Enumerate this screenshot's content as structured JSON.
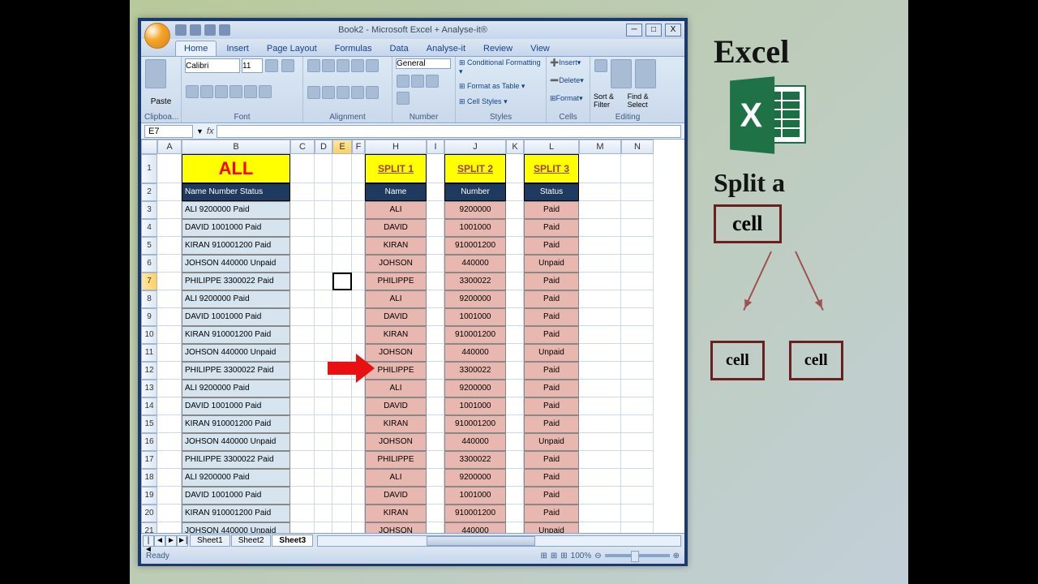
{
  "title": "Book2 - Microsoft Excel + Analyse-it®",
  "tabs": [
    "Home",
    "Insert",
    "Page Layout",
    "Formulas",
    "Data",
    "Analyse-it",
    "Review",
    "View"
  ],
  "activeTab": "Home",
  "ribbonGroups": {
    "clipboard": "Clipboa...",
    "font": "Font",
    "fontName": "Calibri",
    "fontSize": "11",
    "alignment": "Alignment",
    "numberFormat": "General",
    "number": "Number",
    "styles": "Styles",
    "stylesBtns": [
      "Conditional Formatting",
      "Format as Table",
      "Cell Styles"
    ],
    "cells": "Cells",
    "cellsBtns": [
      "Insert",
      "Delete",
      "Format"
    ],
    "editing": "Editing",
    "editBtns": [
      "Sort & Filter",
      "Find & Select"
    ]
  },
  "nameBox": "E7",
  "formulaValue": "",
  "columns": [
    "A",
    "B",
    "C",
    "D",
    "E",
    "F",
    "H",
    "I",
    "J",
    "K",
    "L",
    "M",
    "N"
  ],
  "selectedCol": "E",
  "selectedRow": 7,
  "headerAll": "ALL",
  "splitHeaders": [
    "SPLIT 1",
    "SPLIT 2",
    "SPLIT 3"
  ],
  "row2": {
    "b": "Name Number Status",
    "h": "Name",
    "j": "Number",
    "l": "Status"
  },
  "dataRows": [
    {
      "r": 3,
      "b": "ALI 9200000  Paid",
      "h": "ALI",
      "j": "9200000",
      "l": "Paid"
    },
    {
      "r": 4,
      "b": "DAVID 1001000 Paid",
      "h": "DAVID",
      "j": "1001000",
      "l": "Paid"
    },
    {
      "r": 5,
      "b": "KIRAN 910001200 Paid",
      "h": "KIRAN",
      "j": "910001200",
      "l": "Paid"
    },
    {
      "r": 6,
      "b": "JOHSON 440000 Unpaid",
      "h": "JOHSON",
      "j": "440000",
      "l": "Unpaid"
    },
    {
      "r": 7,
      "b": "PHILIPPE 3300022 Paid",
      "h": "PHILIPPE",
      "j": "3300022",
      "l": "Paid"
    },
    {
      "r": 8,
      "b": "ALI 9200000  Paid",
      "h": "ALI",
      "j": "9200000",
      "l": "Paid"
    },
    {
      "r": 9,
      "b": "DAVID 1001000 Paid",
      "h": "DAVID",
      "j": "1001000",
      "l": "Paid"
    },
    {
      "r": 10,
      "b": "KIRAN 910001200 Paid",
      "h": "KIRAN",
      "j": "910001200",
      "l": "Paid"
    },
    {
      "r": 11,
      "b": "JOHSON 440000 Unpaid",
      "h": "JOHSON",
      "j": "440000",
      "l": "Unpaid"
    },
    {
      "r": 12,
      "b": "PHILIPPE 3300022 Paid",
      "h": "PHILIPPE",
      "j": "3300022",
      "l": "Paid"
    },
    {
      "r": 13,
      "b": "ALI 9200000  Paid",
      "h": "ALI",
      "j": "9200000",
      "l": "Paid"
    },
    {
      "r": 14,
      "b": "DAVID 1001000 Paid",
      "h": "DAVID",
      "j": "1001000",
      "l": "Paid"
    },
    {
      "r": 15,
      "b": "KIRAN 910001200 Paid",
      "h": "KIRAN",
      "j": "910001200",
      "l": "Paid"
    },
    {
      "r": 16,
      "b": "JOHSON 440000 Unpaid",
      "h": "JOHSON",
      "j": "440000",
      "l": "Unpaid"
    },
    {
      "r": 17,
      "b": "PHILIPPE 3300022 Paid",
      "h": "PHILIPPE",
      "j": "3300022",
      "l": "Paid"
    },
    {
      "r": 18,
      "b": "ALI 9200000  Paid",
      "h": "ALI",
      "j": "9200000",
      "l": "Paid"
    },
    {
      "r": 19,
      "b": "DAVID 1001000 Paid",
      "h": "DAVID",
      "j": "1001000",
      "l": "Paid"
    },
    {
      "r": 20,
      "b": "KIRAN 910001200 Paid",
      "h": "KIRAN",
      "j": "910001200",
      "l": "Paid"
    },
    {
      "r": 21,
      "b": "JOHSON 440000 Unpaid",
      "h": "JOHSON",
      "j": "440000",
      "l": "Unpaid"
    }
  ],
  "sheetTabs": [
    "Sheet1",
    "Sheet2",
    "Sheet3"
  ],
  "activeSheet": "Sheet3",
  "status": "Ready",
  "zoom": "100%",
  "side": {
    "title": "Excel",
    "subtitle": "Split a",
    "cell": "cell",
    "cell2": "cell",
    "cell3": "cell"
  }
}
